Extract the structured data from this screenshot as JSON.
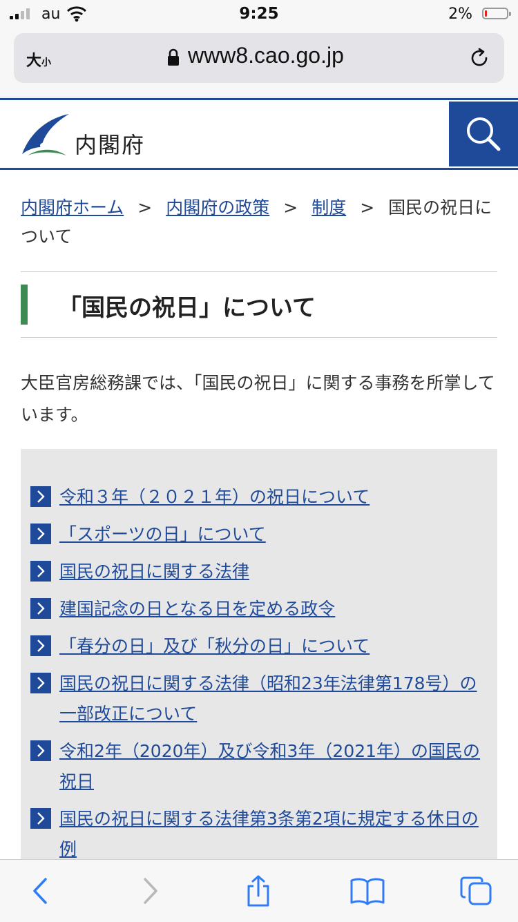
{
  "status_bar": {
    "carrier": "au",
    "time": "9:25",
    "battery_percent": "2%",
    "battery_level": 0.02,
    "battery_color": "#e0231f"
  },
  "browser": {
    "text_size_label_big": "大",
    "text_size_label_small": "小",
    "url": "www8.cao.go.jp",
    "lock_icon": "lock-icon",
    "reload_icon": "reload-icon"
  },
  "site": {
    "name": "内閣府",
    "search_icon": "search-icon",
    "brand_color": "#1f4a9a",
    "accent_color": "#3d8a55"
  },
  "breadcrumb": {
    "items": [
      "内閣府ホーム",
      "内閣府の政策",
      "制度"
    ],
    "separator": ">",
    "current": "国民の祝日について"
  },
  "page": {
    "title": "「国民の祝日」について",
    "intro": "大臣官房総務課では、「国民の祝日」に関する事務を所掌しています。"
  },
  "links": [
    "令和３年（２０２１年）の祝日について",
    "「スポーツの日」について",
    "国民の祝日に関する法律",
    "建国記念の日となる日を定める政令",
    "「春分の日」及び「秋分の日」について",
    "国民の祝日に関する法律（昭和23年法律第178号）の一部改正について",
    "令和2年（2020年）及び令和3年（2021年）の国民の祝日",
    "国民の祝日に関する法律第3条第2項に規定する休日の例"
  ],
  "toolbar": {
    "back_icon": "back-icon",
    "forward_icon": "forward-icon",
    "share_icon": "share-icon",
    "bookmarks_icon": "bookmarks-icon",
    "tabs_icon": "tabs-icon"
  }
}
